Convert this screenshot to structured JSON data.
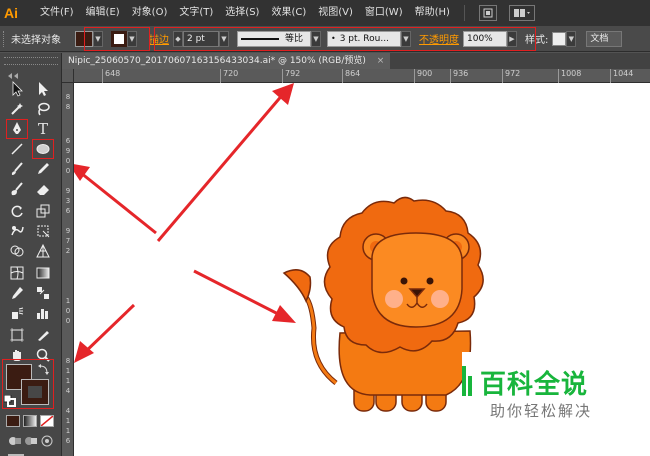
{
  "app": {
    "logo": "Ai"
  },
  "menu": {
    "items": [
      {
        "label": "文件(F)"
      },
      {
        "label": "编辑(E)"
      },
      {
        "label": "对象(O)"
      },
      {
        "label": "文字(T)"
      },
      {
        "label": "选择(S)"
      },
      {
        "label": "效果(C)"
      },
      {
        "label": "视图(V)"
      },
      {
        "label": "窗口(W)"
      },
      {
        "label": "帮助(H)"
      }
    ],
    "bridge_icon": "bridge-icon",
    "arrange_icon": "arrange-documents-icon"
  },
  "control": {
    "selection_label": "未选择对象",
    "stroke_label": "描边",
    "stroke_weight": "2 pt",
    "profile_label": "等比",
    "brush_label": "3 pt. Rou...",
    "opacity_label": "不透明度",
    "opacity_value": "100%",
    "style_label": "样式:",
    "doc_setup_label": "文档",
    "fill_color": "#3b1c12",
    "stroke_color": "#3b1c12"
  },
  "document": {
    "tab_title": "Nipic_25060570_20170607163156433034.ai*  @ 150% (RGB/预览)",
    "close_glyph": "×"
  },
  "ruler": {
    "h_ticks": [
      "648",
      "720",
      "792",
      "864",
      "900",
      "936",
      "972",
      "1008",
      "1044"
    ],
    "v_ticks": [
      "8",
      "8",
      "6",
      "9",
      "0",
      "0",
      "9",
      "3",
      "6",
      "9",
      "7",
      "2",
      "1",
      "0",
      "0",
      "8",
      "1",
      "1",
      "4",
      "4",
      "1",
      "1",
      "6"
    ]
  },
  "toolbar": {
    "tools": [
      {
        "name": "selection-tool-icon"
      },
      {
        "name": "direct-selection-tool-icon"
      },
      {
        "name": "magic-wand-tool-icon"
      },
      {
        "name": "lasso-tool-icon"
      },
      {
        "name": "pen-tool-icon"
      },
      {
        "name": "type-tool-icon",
        "glyph": "T"
      },
      {
        "name": "line-segment-tool-icon"
      },
      {
        "name": "ellipse-tool-icon"
      },
      {
        "name": "paintbrush-tool-icon"
      },
      {
        "name": "pencil-tool-icon"
      },
      {
        "name": "blob-brush-tool-icon"
      },
      {
        "name": "eraser-tool-icon"
      },
      {
        "name": "rotate-tool-icon"
      },
      {
        "name": "scale-tool-icon"
      },
      {
        "name": "warp-tool-icon"
      },
      {
        "name": "free-transform-tool-icon"
      },
      {
        "name": "shape-builder-tool-icon"
      },
      {
        "name": "perspective-grid-tool-icon"
      },
      {
        "name": "mesh-tool-icon"
      },
      {
        "name": "gradient-tool-icon"
      },
      {
        "name": "eyedropper-tool-icon"
      },
      {
        "name": "blend-tool-icon"
      },
      {
        "name": "symbol-sprayer-tool-icon"
      },
      {
        "name": "column-graph-tool-icon"
      },
      {
        "name": "artboard-tool-icon"
      },
      {
        "name": "slice-tool-icon"
      },
      {
        "name": "hand-tool-icon"
      },
      {
        "name": "zoom-tool-icon"
      }
    ],
    "fill_swatch_color": "#3b1c12",
    "stroke_swatch_color": "#3b1c12"
  },
  "colors": {
    "accent_orange": "#ff9a00",
    "highlight_red": "#e02020",
    "lion_mane": "#f06a10",
    "lion_face": "#fb8a22",
    "lion_outline": "#7a2a0a",
    "watermark_green": "#18b53c"
  },
  "watermark": {
    "title": "百科全说",
    "subtitle": "助你轻松解决"
  }
}
